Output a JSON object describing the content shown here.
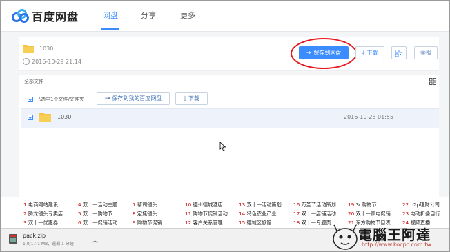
{
  "header": {
    "logo_text": "百度网盘",
    "nav": [
      {
        "label": "网盘"
      },
      {
        "label": "分享"
      },
      {
        "label": "更多"
      }
    ]
  },
  "share": {
    "name": "1030",
    "date": "2016-10-29 21:14",
    "save_button": "保存到网盘",
    "download_button": "下载",
    "report_button": "举报"
  },
  "list": {
    "all_files_label": "全部文件",
    "selected_label": "已选中1个文件/文件夹",
    "save_to_my_button": "保存到我的百度网盘",
    "download_button": "下载",
    "rows": [
      {
        "name": "1030",
        "size": "-",
        "date": "2016-10-28 01:55"
      }
    ]
  },
  "ads": [
    {
      "num": "1",
      "text": "电商网站建设"
    },
    {
      "num": "2",
      "text": "腾龙镜头专卖店"
    },
    {
      "num": "3",
      "text": "双十一优惠券"
    },
    {
      "num": "4",
      "text": "双十一活动主题"
    },
    {
      "num": "5",
      "text": "双十一购物节"
    },
    {
      "num": "6",
      "text": "双十一促销活动"
    },
    {
      "num": "7",
      "text": "帮司镜头"
    },
    {
      "num": "8",
      "text": "定焦镜头"
    },
    {
      "num": "9",
      "text": "购物节促销"
    },
    {
      "num": "10",
      "text": "德州德城酒店"
    },
    {
      "num": "11",
      "text": "购物节促销活动"
    },
    {
      "num": "12",
      "text": "客户关系管理"
    },
    {
      "num": "13",
      "text": "双十一活动策划"
    },
    {
      "num": "14",
      "text": "特色农业产业"
    },
    {
      "num": "15",
      "text": "德城区旅馆"
    },
    {
      "num": "16",
      "text": "万圣节活动策划"
    },
    {
      "num": "17",
      "text": "双十一店铺活动"
    },
    {
      "num": "18",
      "text": "双十一专题页"
    },
    {
      "num": "19",
      "text": "3c购物节"
    },
    {
      "num": "20",
      "text": "双十一家电促销"
    },
    {
      "num": "21",
      "text": "东方购物节目表"
    },
    {
      "num": "22",
      "text": "p2p理财公司"
    },
    {
      "num": "23",
      "text": "电动折叠自行"
    },
    {
      "num": "24",
      "text": "视频直播"
    }
  ],
  "download_bar": {
    "file_name": "pack.zip",
    "file_status": "1.0/17.1 MB，還剩 1 分鐘"
  },
  "watermark": {
    "title": "電腦王阿達",
    "url": "http://www.kocpc.com.tw"
  }
}
